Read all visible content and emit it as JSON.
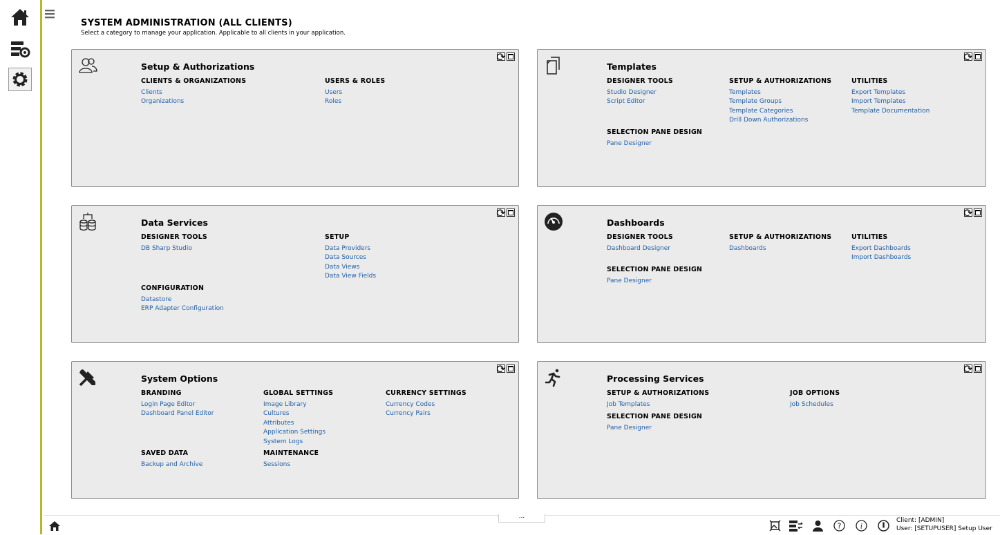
{
  "header": {
    "title": "SYSTEM ADMINISTRATION (ALL CLIENTS)",
    "subtitle": "Select a category to manage your application. Applicable to all clients in your application."
  },
  "panels": {
    "setup": {
      "title": "Setup & Authorizations",
      "sections": [
        {
          "heading": "CLIENTS & ORGANIZATIONS",
          "links": [
            "Clients",
            "Organizations"
          ]
        },
        {
          "heading": "USERS & ROLES",
          "links": [
            "Users",
            "Roles"
          ]
        }
      ]
    },
    "templates": {
      "title": "Templates",
      "sections": [
        {
          "heading": "DESIGNER TOOLS",
          "links": [
            "Studio Designer",
            "Script Editor"
          ]
        },
        {
          "heading": "SETUP & AUTHORIZATIONS",
          "links": [
            "Templates",
            "Template Groups",
            "Template Categories",
            "Drill Down Authorizations"
          ]
        },
        {
          "heading": "UTILITIES",
          "links": [
            "Export Templates",
            "Import Templates",
            "Template Documentation"
          ]
        },
        {
          "heading": "SELECTION PANE DESIGN",
          "links": [
            "Pane Designer"
          ]
        }
      ]
    },
    "data": {
      "title": "Data Services",
      "sections": [
        {
          "heading": "DESIGNER TOOLS",
          "links": [
            "DB Sharp Studio"
          ]
        },
        {
          "heading": "SETUP",
          "links": [
            "Data Providers",
            "Data Sources",
            "Data Views",
            "Data View Fields"
          ]
        },
        {
          "heading": "CONFIGURATION",
          "links": [
            "Datastore",
            "ERP Adapter Configuration"
          ]
        }
      ]
    },
    "dashboards": {
      "title": "Dashboards",
      "sections": [
        {
          "heading": "DESIGNER TOOLS",
          "links": [
            "Dashboard Designer"
          ]
        },
        {
          "heading": "SETUP & AUTHORIZATIONS",
          "links": [
            "Dashboards"
          ]
        },
        {
          "heading": "UTILITIES",
          "links": [
            "Export Dashboards",
            "Import Dashboards"
          ]
        },
        {
          "heading": "SELECTION PANE DESIGN",
          "links": [
            "Pane Designer"
          ]
        }
      ]
    },
    "system": {
      "title": "System Options",
      "sections": [
        {
          "heading": "BRANDING",
          "links": [
            "Login Page Editor",
            "Dashboard Panel Editor"
          ]
        },
        {
          "heading": "GLOBAL SETTINGS",
          "links": [
            "Image Library",
            "Cultures",
            "Attributes",
            "Application Settings",
            "System Logs"
          ]
        },
        {
          "heading": "CURRENCY SETTINGS",
          "links": [
            "Currency Codes",
            "Currency Pairs"
          ]
        },
        {
          "heading": "SAVED DATA",
          "links": [
            "Backup and Archive"
          ]
        },
        {
          "heading": "MAINTENANCE",
          "links": [
            "Sessions"
          ]
        }
      ]
    },
    "processing": {
      "title": "Processing Services",
      "sections": [
        {
          "heading": "SETUP & AUTHORIZATIONS",
          "links": [
            "Job Templates"
          ]
        },
        {
          "heading": "JOB OPTIONS",
          "links": [
            "Job Schedules"
          ]
        },
        {
          "heading": "SELECTION PANE DESIGN",
          "links": [
            "Pane Designer"
          ]
        }
      ]
    }
  },
  "footer": {
    "dots": "...",
    "client": "Client: [ADMIN]",
    "user": "User: [SETUPUSER] Setup User"
  },
  "colors": {
    "accent_border": "#b5b82a",
    "link": "#1f5fa8",
    "panel_bg": "#ebebeb"
  }
}
